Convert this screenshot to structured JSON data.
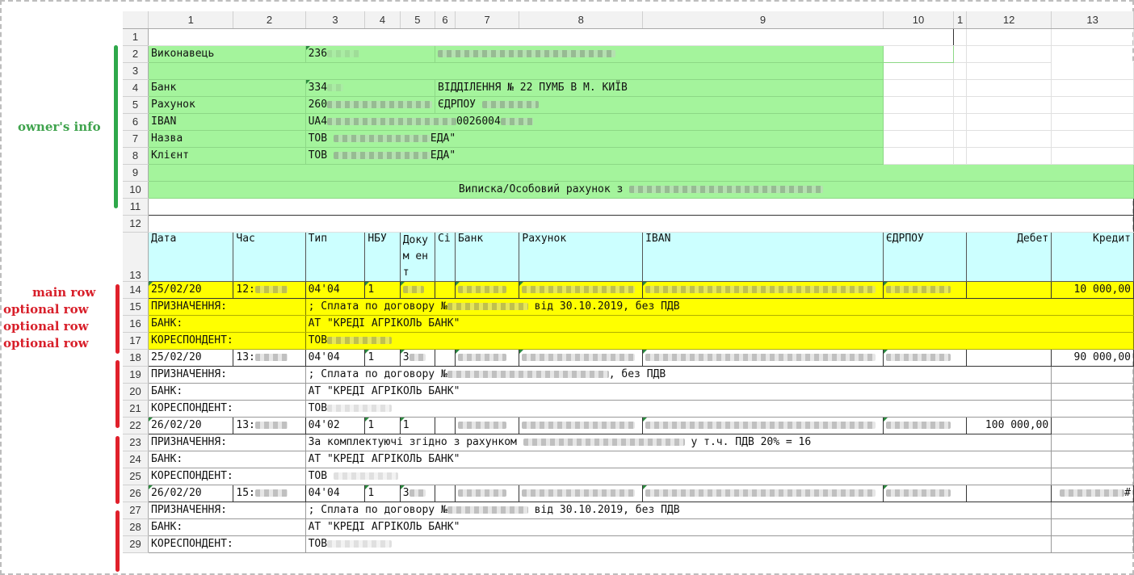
{
  "annotations": {
    "owner_info": "owner's info",
    "main_row": "main row",
    "optional_row": "optional row"
  },
  "columns": [
    "1",
    "2",
    "3",
    "4",
    "5",
    "6",
    "7",
    "8",
    "9",
    "10",
    "1",
    "12",
    "13"
  ],
  "rows": {
    "r2": {
      "a": "Виконавець",
      "c": "236"
    },
    "r4": {
      "a": "Банк",
      "c": "334",
      "f": "ВІДДІЛЕННЯ № 22 ПУМБ В М. КИЇВ"
    },
    "r5": {
      "a": "Рахунок",
      "c": "260",
      "f": "ЄДРПОУ"
    },
    "r6": {
      "a": "IBAN",
      "c": "UA4",
      "c2": "0026004"
    },
    "r7": {
      "a": "Назва",
      "c": "ТОВ",
      "c2": "ЕДА\""
    },
    "r8": {
      "a": "Клієнт",
      "c": "ТОВ",
      "c2": "ЕДА\""
    },
    "r10": {
      "title": "Виписка/Особовий рахунок з"
    },
    "r13": [
      "Дата",
      "Час",
      "Тип",
      "НБУ",
      "Докум ент",
      "Сі",
      "Банк",
      "Рахунок",
      "IBAN",
      "ЄДРПОУ",
      "Дебет",
      "Кредит"
    ],
    "r14": {
      "date": "25/02/20",
      "time": "12:",
      "type": "04'04",
      "nbu": "1",
      "credit": "10 000,00"
    },
    "r15": {
      "label": "ПРИЗНАЧЕННЯ:",
      "text": "; Сплата по договору №",
      "text2": " від 30.10.2019, без ПДВ"
    },
    "r16": {
      "label": "БАНК:",
      "text": "АТ \"КРЕДІ АГРІКОЛЬ БАНК\""
    },
    "r17": {
      "label": "КОРЕСПОНДЕНТ:",
      "text": "ТОВ"
    },
    "r18": {
      "date": "25/02/20",
      "time": "13:",
      "type": "04'04",
      "nbu": "1",
      "doc": "3",
      "credit": "90 000,00"
    },
    "r19": {
      "label": "ПРИЗНАЧЕННЯ:",
      "text": "; Сплата по договору №",
      "text2": ", без ПДВ"
    },
    "r20": {
      "label": "БАНК:",
      "text": "АТ \"КРЕДІ АГРІКОЛЬ БАНК\""
    },
    "r21": {
      "label": "КОРЕСПОНДЕНТ:",
      "text": "ТОВ"
    },
    "r22": {
      "date": "26/02/20",
      "time": "13:",
      "type": "04'02",
      "nbu": "1",
      "doc": "1",
      "debit": "100 000,00"
    },
    "r23": {
      "label": "ПРИЗНАЧЕННЯ:",
      "text": "За комплектуючі згідно з рахунком",
      "text2": " у т.ч. ПДВ 20% = 16"
    },
    "r24": {
      "label": "БАНК:",
      "text": "АТ \"КРЕДІ АГРІКОЛЬ БАНК\""
    },
    "r25": {
      "label": "КОРЕСПОНДЕНТ:",
      "text": "ТОВ"
    },
    "r26": {
      "date": "26/02/20",
      "time": "15:",
      "type": "04'04",
      "nbu": "1",
      "doc": "3",
      "credit": "#"
    },
    "r27": {
      "label": "ПРИЗНАЧЕННЯ:",
      "text": "; Сплата по договору №",
      "text2": " від 30.10.2019, без ПДВ"
    },
    "r28": {
      "label": "БАНК:",
      "text": "АТ \"КРЕДІ АГРІКОЛЬ БАНК\""
    },
    "r29": {
      "label": "КОРЕСПОНДЕНТ:",
      "text": "ТОВ"
    }
  }
}
